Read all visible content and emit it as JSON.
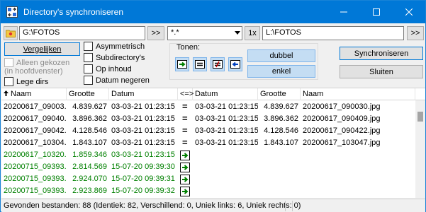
{
  "window": {
    "title": "Directory's synchroniseren"
  },
  "left": {
    "path": "G:\\FOTOS",
    "browse_label": ">>",
    "compare_label": "Vergelijken"
  },
  "mask": {
    "value": "*.*",
    "once_label": "1x"
  },
  "right": {
    "path": "L:\\FOTOS",
    "browse_label": ">>"
  },
  "options": {
    "only_selected": "Alleen gekozen",
    "only_selected_sub": "(in hoofdvenster)",
    "empty_dirs": "Lege dirs",
    "asymmetric": "Asymmetrisch",
    "subdirs": "Subdirectory's",
    "by_content": "Op inhoud",
    "ignore_date": "Datum negeren"
  },
  "show": {
    "label": "Tonen:",
    "double_label": "dubbel",
    "single_label": "enkel"
  },
  "actions": {
    "sync_label": "Synchroniseren",
    "close_label": "Sluiten"
  },
  "table": {
    "headers": [
      "Naam",
      "Grootte",
      "Datum",
      "<=>",
      "Datum",
      "Grootte",
      "Naam"
    ],
    "rows": [
      {
        "lname": "20200617_09003...",
        "lsize": "4.839.627",
        "ldate": "03-03-21 01:23:15",
        "op": "=",
        "rdate": "03-03-21 01:23:15",
        "rsize": "4.839.627",
        "rname": "20200617_090030.jpg"
      },
      {
        "lname": "20200617_09040...",
        "lsize": "3.896.362",
        "ldate": "03-03-21 01:23:15",
        "op": "=",
        "rdate": "03-03-21 01:23:15",
        "rsize": "3.896.362",
        "rname": "20200617_090409.jpg"
      },
      {
        "lname": "20200617_09042...",
        "lsize": "4.128.546",
        "ldate": "03-03-21 01:23:15",
        "op": "=",
        "rdate": "03-03-21 01:23:15",
        "rsize": "4.128.546",
        "rname": "20200617_090422.jpg"
      },
      {
        "lname": "20200617_10304...",
        "lsize": "1.843.107",
        "ldate": "03-03-21 01:23:15",
        "op": "=",
        "rdate": "03-03-21 01:23:15",
        "rsize": "1.843.107",
        "rname": "20200617_103047.jpg"
      },
      {
        "lname": "20200617_10320...",
        "lsize": "1.859.346",
        "ldate": "03-03-21 01:23:15",
        "op": "→",
        "rdate": "",
        "rsize": "",
        "rname": ""
      },
      {
        "lname": "20200715_09393...",
        "lsize": "2.814.569",
        "ldate": "15-07-20 09:39:30",
        "op": "→",
        "rdate": "",
        "rsize": "",
        "rname": ""
      },
      {
        "lname": "20200715_09393...",
        "lsize": "2.924.070",
        "ldate": "15-07-20 09:39:31",
        "op": "→",
        "rdate": "",
        "rsize": "",
        "rname": ""
      },
      {
        "lname": "20200715_09393...",
        "lsize": "2.923.869",
        "ldate": "15-07-20 09:39:32",
        "op": "→",
        "rdate": "",
        "rsize": "",
        "rname": ""
      }
    ]
  },
  "status": {
    "text": "Gevonden bestanden: 88  (Identiek: 82, Verschillend: 0, Uniek links: 6, Uniek rechts: 0)"
  }
}
